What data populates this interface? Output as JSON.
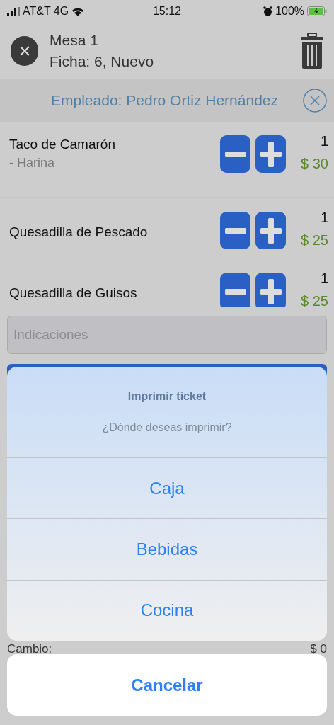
{
  "status_bar": {
    "carrier": "AT&T 4G",
    "time": "15:12",
    "battery": "100%"
  },
  "header": {
    "title": "Mesa 1",
    "subtitle": "Ficha: 6, Nuevo"
  },
  "employee": {
    "label": "Empleado: Pedro Ortiz Hernández"
  },
  "items": [
    {
      "name": "Taco de Camarón",
      "note": "- Harina",
      "qty": "1",
      "price": "$ 30"
    },
    {
      "name": "Quesadilla de Pescado",
      "qty": "1",
      "price": "$ 25"
    },
    {
      "name": "Quesadilla de Guisos",
      "qty": "1",
      "price": "$ 25"
    }
  ],
  "notes_field": {
    "placeholder": "Indicaciones"
  },
  "totals": [
    {
      "label": "Cambio:",
      "value": "$ 0"
    }
  ],
  "action_sheet": {
    "title": "Imprimir ticket",
    "message": "¿Dónde deseas imprimir?",
    "actions": [
      "Caja",
      "Bebidas",
      "Cocina"
    ],
    "cancel": "Cancelar"
  }
}
